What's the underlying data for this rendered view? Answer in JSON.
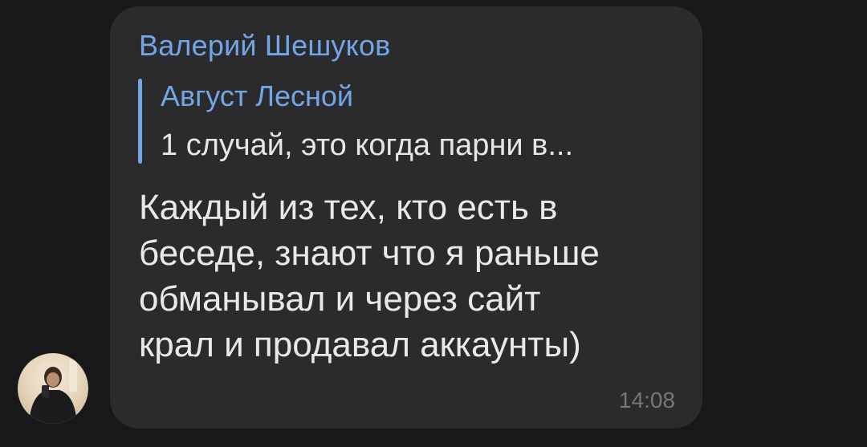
{
  "message": {
    "sender_name": "Валерий Шешуков",
    "reply": {
      "author": "Август Лесной",
      "preview": "1 случай, это когда парни в..."
    },
    "text_lines": [
      "Каждый из тех, кто есть в",
      "беседе, знают что я раньше",
      "обманывал и через сайт",
      "крал и продавал аккаунты)"
    ],
    "time": "14:08"
  },
  "avatar": {
    "icon": "user-avatar-photo"
  },
  "colors": {
    "background": "#18181a",
    "bubble": "#2b2b2d",
    "accent": "#72a6e6",
    "text": "#e9e9e9",
    "timestamp": "#77777a"
  }
}
